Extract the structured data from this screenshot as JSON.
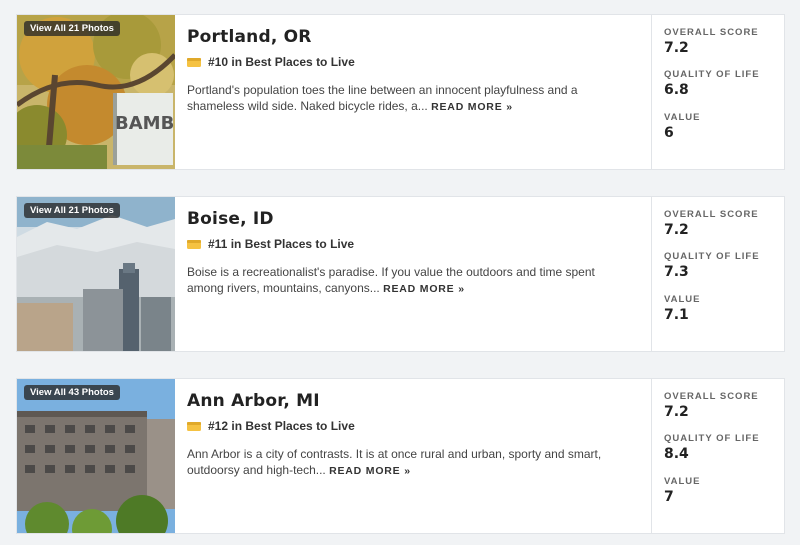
{
  "colors": {
    "rank_icon": "#f5c242",
    "badge_bg": "#333333",
    "card_border": "#e1e4e8"
  },
  "labels": {
    "read_more": "READ MORE »",
    "overall": "OVERALL SCORE",
    "quality": "QUALITY OF LIFE",
    "value": "VALUE"
  },
  "listings": [
    {
      "photos": "View All 21 Photos",
      "city": "Portland, OR",
      "rank": "#10 in Best Places to Live",
      "description": "Portland's population toes the line between an innocent playfulness and a shameless wild side. Naked bicycle rides, a...",
      "overall": "7.2",
      "quality": "6.8",
      "value": "6"
    },
    {
      "photos": "View All 21 Photos",
      "city": "Boise, ID",
      "rank": "#11 in Best Places to Live",
      "description": "Boise is a recreationalist's paradise. If you value the outdoors and time spent among rivers, mountains, canyons...",
      "overall": "7.2",
      "quality": "7.3",
      "value": "7.1"
    },
    {
      "photos": "View All 43 Photos",
      "city": "Ann Arbor, MI",
      "rank": "#12 in Best Places to Live",
      "description": "Ann Arbor is a city of contrasts. It is at once rural and urban, sporty and smart, outdoorsy and high-tech...",
      "overall": "7.2",
      "quality": "8.4",
      "value": "7"
    }
  ]
}
